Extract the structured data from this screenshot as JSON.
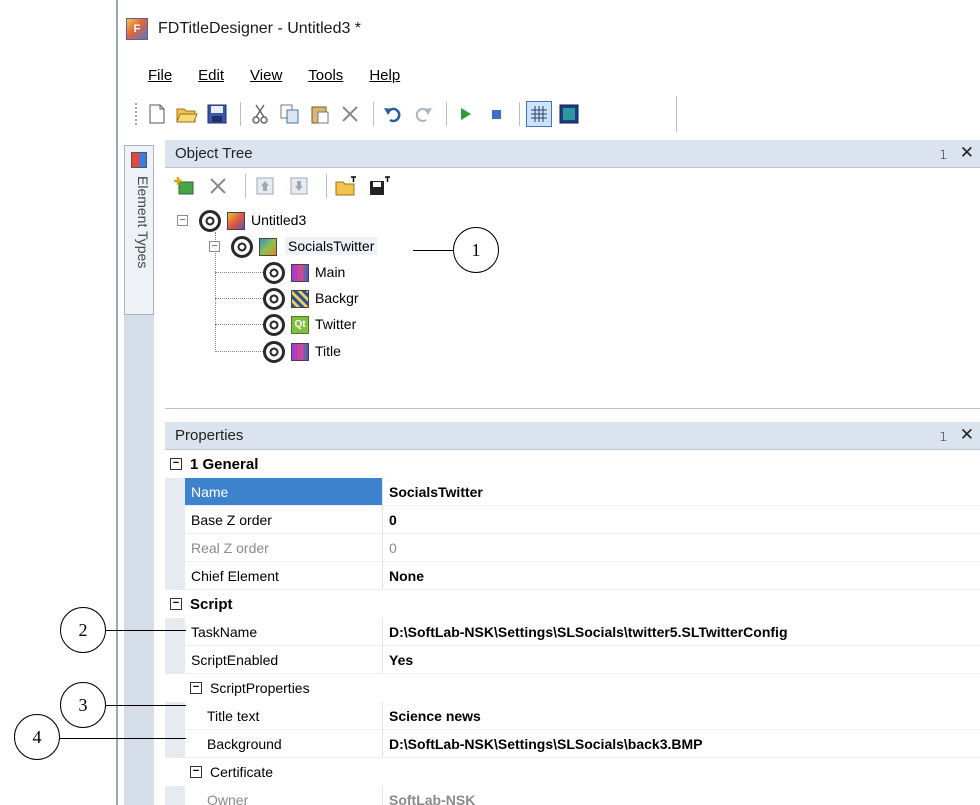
{
  "window": {
    "title": "FDTitleDesigner - Untitled3 *"
  },
  "menu": [
    "File",
    "Edit",
    "View",
    "Tools",
    "Help"
  ],
  "toolbar": {
    "icons": [
      "new-icon",
      "open-icon",
      "save-icon",
      "cut-icon",
      "copy-icon",
      "paste-icon",
      "delete-icon",
      "undo-icon",
      "redo-icon",
      "play-icon",
      "stop-icon",
      "grid-icon",
      "preview-icon"
    ]
  },
  "side_tab": {
    "label": "Element Types"
  },
  "object_tree": {
    "title": "Object Tree",
    "pin": "4",
    "close": "✕",
    "nodes": [
      {
        "label": "Untitled3"
      },
      {
        "label": "SocialsTwitter"
      },
      {
        "label": "Main"
      },
      {
        "label": "Backgr"
      },
      {
        "label": "Twitter"
      },
      {
        "label": "Title"
      }
    ]
  },
  "properties": {
    "title": "Properties",
    "categories": {
      "general": "1 General",
      "script": "Script",
      "script_properties": "ScriptProperties",
      "certificate": "Certificate"
    },
    "rows": {
      "name": {
        "name": "Name",
        "value": "SocialsTwitter"
      },
      "base_z": {
        "name": "Base Z order",
        "value": "0"
      },
      "real_z": {
        "name": "Real Z order",
        "value": "0"
      },
      "chief": {
        "name": "Chief Element",
        "value": "None"
      },
      "task": {
        "name": "TaskName",
        "value": "D:\\SoftLab-NSK\\Settings\\SLSocials\\twitter5.SLTwitterConfig"
      },
      "enabled": {
        "name": "ScriptEnabled",
        "value": "Yes"
      },
      "title_text": {
        "name": "Title text",
        "value": "Science news"
      },
      "background": {
        "name": "Background",
        "value": "D:\\SoftLab-NSK\\Settings\\SLSocials\\back3.BMP"
      },
      "owner": {
        "name": "Owner",
        "value": "SoftLab-NSK"
      }
    }
  },
  "callouts": [
    "1",
    "2",
    "3",
    "4"
  ],
  "colors": {
    "selection": "#3d82cc",
    "panel_header": "#dbe3ee"
  }
}
